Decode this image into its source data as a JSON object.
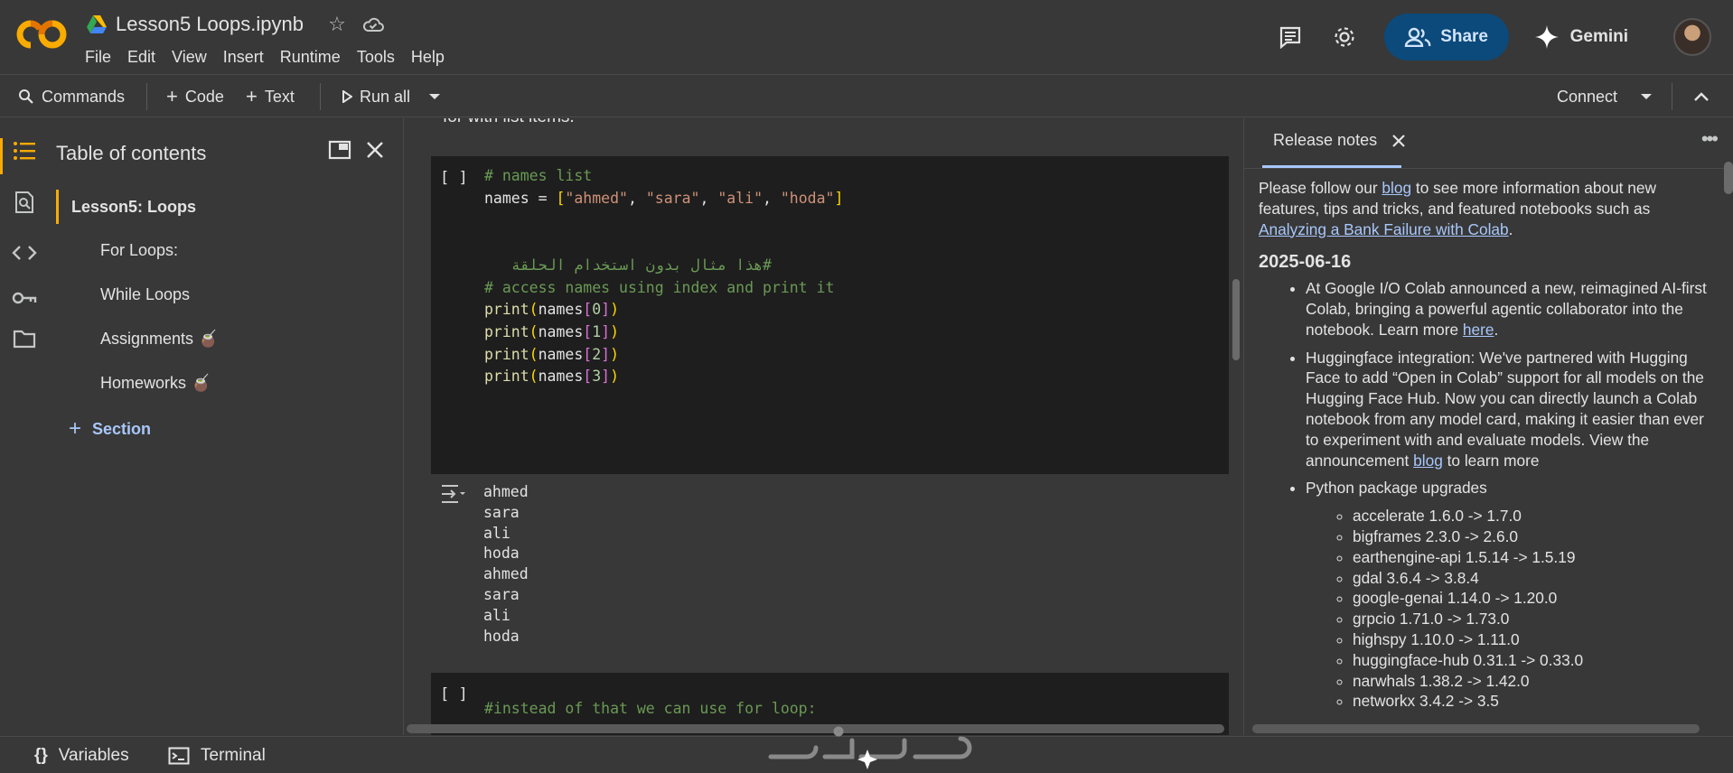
{
  "header": {
    "notebook_title": "Lesson5 Loops.ipynb",
    "menu": [
      "File",
      "Edit",
      "View",
      "Insert",
      "Runtime",
      "Tools",
      "Help"
    ],
    "share_label": "Share",
    "gemini_label": "Gemini"
  },
  "toolbar": {
    "commands_label": "Commands",
    "code_label": "Code",
    "text_label": "Text",
    "run_all_label": "Run all",
    "connect_label": "Connect"
  },
  "toc": {
    "title": "Table of contents",
    "main_item": "Lesson5: Loops",
    "items": [
      "For Loops:",
      "While Loops",
      "Assignments 🧉",
      "Homeworks 🧉"
    ],
    "section_label": "Section"
  },
  "notebook": {
    "prev_text": "for with list items.",
    "cell1": {
      "run_label": "[ ]",
      "line1": "# names list",
      "line2_var": "names = ",
      "line2_items": [
        "\"ahmed\"",
        "\"sara\"",
        "\"ali\"",
        "\"hoda\""
      ],
      "arabic_comment": "#هذا مثال بدون استخدام الحلقة",
      "line_comment2": "# access names using index and print it",
      "print_fn": "print",
      "print_var": "names",
      "indices": [
        "0",
        "1",
        "2",
        "3"
      ]
    },
    "output_lines": [
      "ahmed",
      "sara",
      "ali",
      "hoda",
      "ahmed",
      "sara",
      "ali",
      "hoda"
    ],
    "cell2": {
      "run_label": "[ ]",
      "line1": "#instead of that we can use for loop:"
    }
  },
  "release_notes": {
    "tab_label": "Release notes",
    "intro_pre": "Please follow our ",
    "intro_link1": "blog",
    "intro_mid": " to see more information about new features, tips and tricks, and featured notebooks such as ",
    "intro_link2": "Analyzing a Bank Failure with Colab",
    "intro_post": ".",
    "date": "2025-06-16",
    "bullet1_pre": "At Google I/O Colab announced a new, reimagined AI-first Colab, bringing a powerful agentic collaborator into the notebook. Learn more ",
    "bullet1_link": "here",
    "bullet1_post": ".",
    "bullet2_pre": "Huggingface integration: We've partnered with Hugging Face to add “Open in Colab” support for all models on the Hugging Face Hub. Now you can directly launch a Colab notebook from any model card, making it easier than ever to experiment with and evaluate models. View the announcement ",
    "bullet2_link": "blog",
    "bullet2_post": " to learn more",
    "bullet3": "Python package upgrades",
    "packages": [
      "accelerate 1.6.0 -> 1.7.0",
      "bigframes 2.3.0 -> 2.6.0",
      "earthengine-api 1.5.14 -> 1.5.19",
      "gdal 3.6.4 -> 3.8.4",
      "google-genai 1.14.0 -> 1.20.0",
      "grpcio 1.71.0 -> 1.73.0",
      "highspy 1.10.0 -> 1.11.0",
      "huggingface-hub 0.31.1 -> 0.33.0",
      "narwhals 1.38.2 -> 1.42.0",
      "networkx 3.4.2 -> 3.5"
    ]
  },
  "bottom": {
    "variables_label": "Variables",
    "terminal_label": "Terminal"
  },
  "colors": {
    "accent_orange": "#f9ab00",
    "share_bg": "#0b4a7a",
    "link_blue": "#a8c7fa"
  }
}
